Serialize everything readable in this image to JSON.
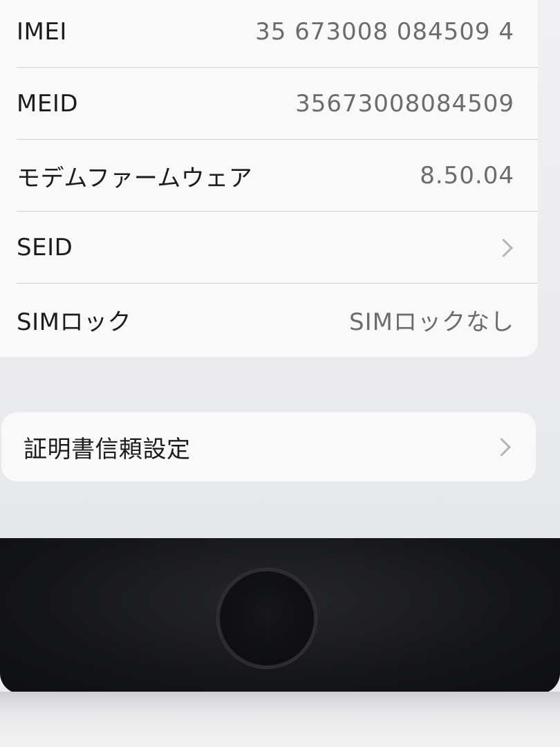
{
  "about": {
    "rows": [
      {
        "label": "IMEI",
        "value": "35 673008 084509 4"
      },
      {
        "label": "MEID",
        "value": "35673008084509"
      },
      {
        "label": "モデムファームウェア",
        "value": "8.50.04"
      },
      {
        "label": "SEID",
        "value": ""
      },
      {
        "label": "SIMロック",
        "value": "SIMロックなし"
      }
    ],
    "certificate_trust": {
      "label": "証明書信頼設定"
    }
  },
  "icons": {
    "chevron": "chevron-right-icon",
    "home_button": "home-button"
  },
  "colors": {
    "background": "#f0f0f3",
    "cell": "#f9f9fa",
    "label": "#1c1c1e",
    "value": "#6b6b70",
    "bezel": "#161719"
  }
}
